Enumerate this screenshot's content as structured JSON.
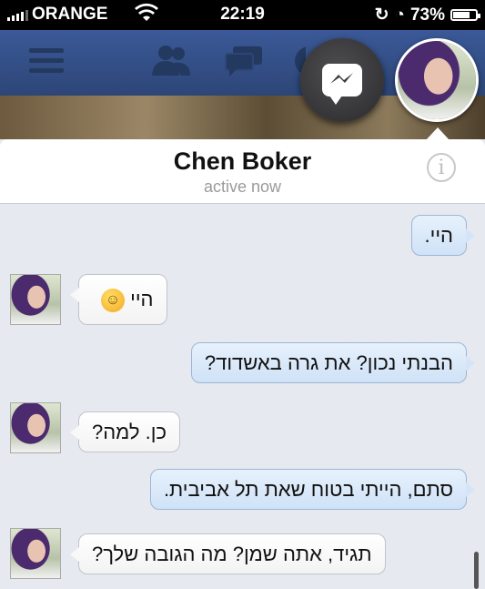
{
  "statusbar": {
    "carrier": "ORANGE",
    "time": "22:19",
    "battery": "73%",
    "battery_level": 0.73,
    "icons": [
      "signal-icon",
      "wifi-icon",
      "rotation-lock-icon",
      "alarm-icon",
      "battery-icon"
    ]
  },
  "fbbar": {
    "icons": [
      "menu-icon",
      "friend-requests-icon",
      "messages-icon",
      "notifications-icon"
    ]
  },
  "chat_heads": [
    "messenger-icon",
    "contact-avatar"
  ],
  "header": {
    "name": "Chen Boker",
    "status": "active now",
    "info_icon": "i"
  },
  "messages": [
    {
      "direction": "outgoing",
      "text": "היי."
    },
    {
      "direction": "incoming",
      "text": "היי",
      "emoji": "smiley"
    },
    {
      "direction": "outgoing",
      "text": "הבנתי נכון? את גרה באשדוד?"
    },
    {
      "direction": "incoming",
      "text": "כן. למה?"
    },
    {
      "direction": "outgoing",
      "text": "סתם, הייתי בטוח שאת תל אביבית."
    },
    {
      "direction": "incoming",
      "text": "תגיד, אתה שמן? מה הגובה שלך?"
    }
  ],
  "colors": {
    "facebook_blue": "#3b5998",
    "outgoing_bubble": "#cfe2f7",
    "incoming_bubble": "#ffffff",
    "thread_bg": "#e6e9ef"
  }
}
